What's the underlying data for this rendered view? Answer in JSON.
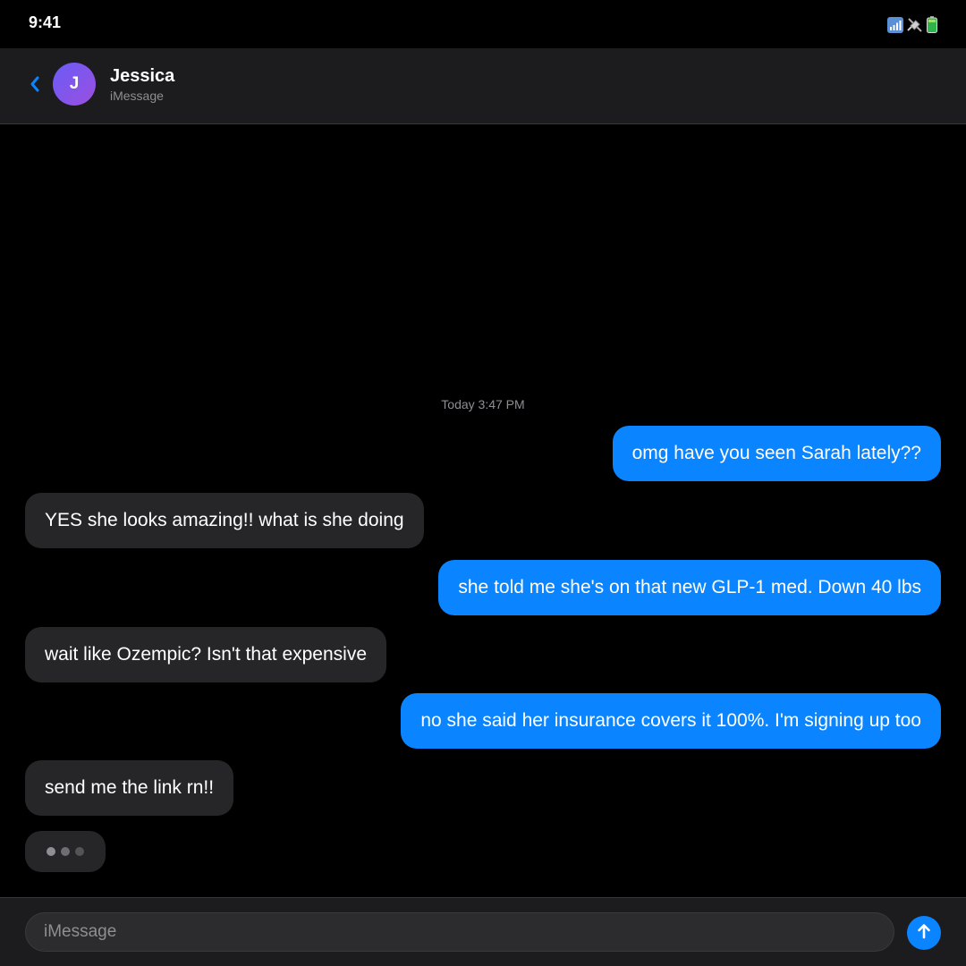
{
  "status_bar": {
    "time": "9:41",
    "icons": [
      "signal-icon",
      "satellite-icon",
      "battery-icon"
    ]
  },
  "header": {
    "back_icon": "chevron-left-icon",
    "avatar_initial": "J",
    "contact_name": "Jessica",
    "service": "iMessage"
  },
  "conversation": {
    "timestamp": "Today 3:47 PM",
    "messages": [
      {
        "direction": "sent",
        "text": "omg have you seen Sarah lately??"
      },
      {
        "direction": "received",
        "text": "YES she looks amazing!! what is she doing"
      },
      {
        "direction": "sent",
        "text": "she told me she's on that new GLP-1 med. Down 40 lbs"
      },
      {
        "direction": "received",
        "text": "wait like Ozempic? Isn't that expensive"
      },
      {
        "direction": "sent",
        "text": "no she said her insurance covers it 100%. I'm signing up too"
      },
      {
        "direction": "received",
        "text": "send me the link rn!!"
      }
    ],
    "typing_indicator": true
  },
  "composer": {
    "placeholder": "iMessage",
    "value": "",
    "send_icon": "arrow-up-icon"
  },
  "colors": {
    "background": "#000000",
    "bar_background": "#1c1c1e",
    "sent_bubble": "#0a84ff",
    "received_bubble": "#262628",
    "secondary_text": "#8e8e93",
    "accent": "#0a84ff",
    "avatar_gradient_start": "#6a5cf6",
    "avatar_gradient_end": "#9b4fe0"
  }
}
